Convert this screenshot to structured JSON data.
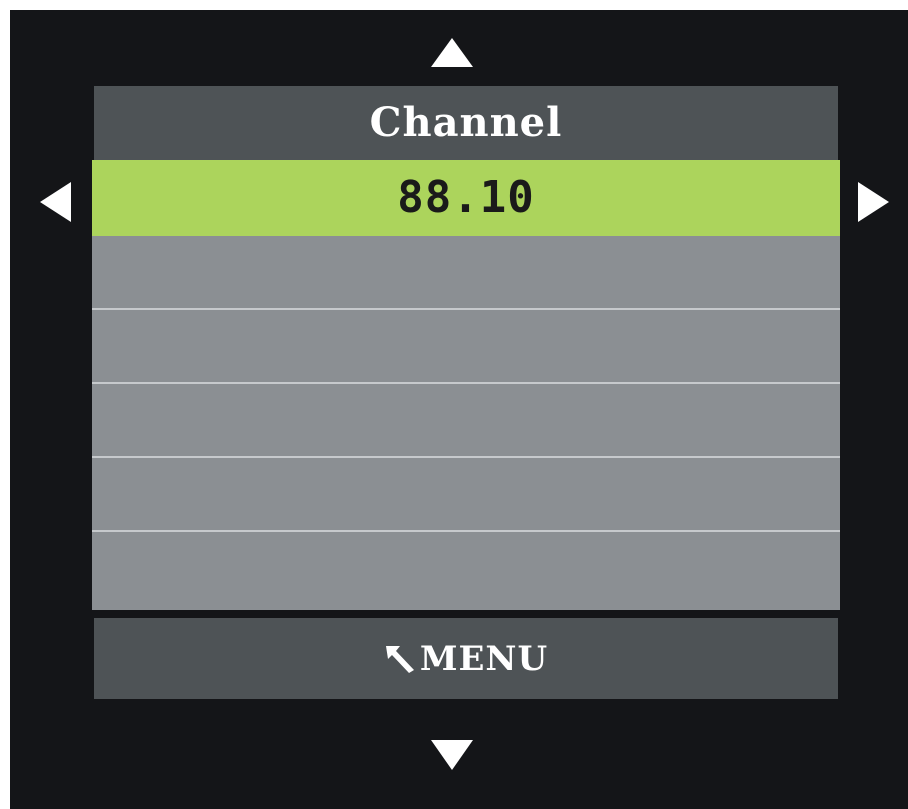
{
  "screen": {
    "title": "Channel",
    "selected_value": "88.10",
    "list_rows": [
      "88.10",
      "",
      "",
      "",
      "",
      ""
    ],
    "menu_label": "MENU"
  },
  "icons": {
    "up": "arrow-up-icon",
    "down": "arrow-down-icon",
    "left": "arrow-left-icon",
    "right": "arrow-right-icon",
    "back": "return-arrow-icon"
  },
  "colors": {
    "background": "#141518",
    "header": "#4e5356",
    "row": "#8b8f93",
    "selected_row": "#acd45c",
    "divider": "#c6c9cc",
    "text": "#ffffff"
  }
}
